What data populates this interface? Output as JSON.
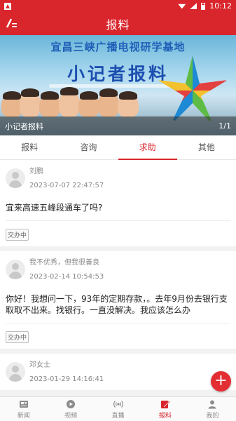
{
  "status_bar": {
    "time": "10:12"
  },
  "header": {
    "title": "报料"
  },
  "banner": {
    "subtitle": "宜昌三峡广播电视研学基地",
    "headline": "小记者报料",
    "caption": "小记者报料",
    "pager": "1/1"
  },
  "tabs": [
    {
      "label": "报料"
    },
    {
      "label": "咨询"
    },
    {
      "label": "求助",
      "active": true
    },
    {
      "label": "其他"
    }
  ],
  "posts": [
    {
      "author": "刘鹏",
      "time": "2023-07-07 22:47:57",
      "content": "宜来高速五峰段通车了吗?",
      "status": "交办中"
    },
    {
      "author": "我不优秀，但我很善良",
      "time": "2023-02-14 10:54:53",
      "content": "你好！我想问一下，93年的定期存款，。去年9月份去银行支取取不出来。找银行。一直没解决。我应该怎么办",
      "status": "交办中"
    },
    {
      "author": "邓女士",
      "time": "2023-01-29 14:16:41",
      "content": "",
      "status": ""
    }
  ],
  "fab": {
    "label": "+"
  },
  "bottom_nav": [
    {
      "label": "新闻",
      "icon": "news-icon"
    },
    {
      "label": "视频",
      "icon": "video-icon"
    },
    {
      "label": "直播",
      "icon": "live-icon"
    },
    {
      "label": "报料",
      "icon": "report-icon",
      "active": true
    },
    {
      "label": "我的",
      "icon": "profile-icon"
    }
  ],
  "colors": {
    "brand": "#d9262c",
    "inactive": "#8c8c8c"
  }
}
